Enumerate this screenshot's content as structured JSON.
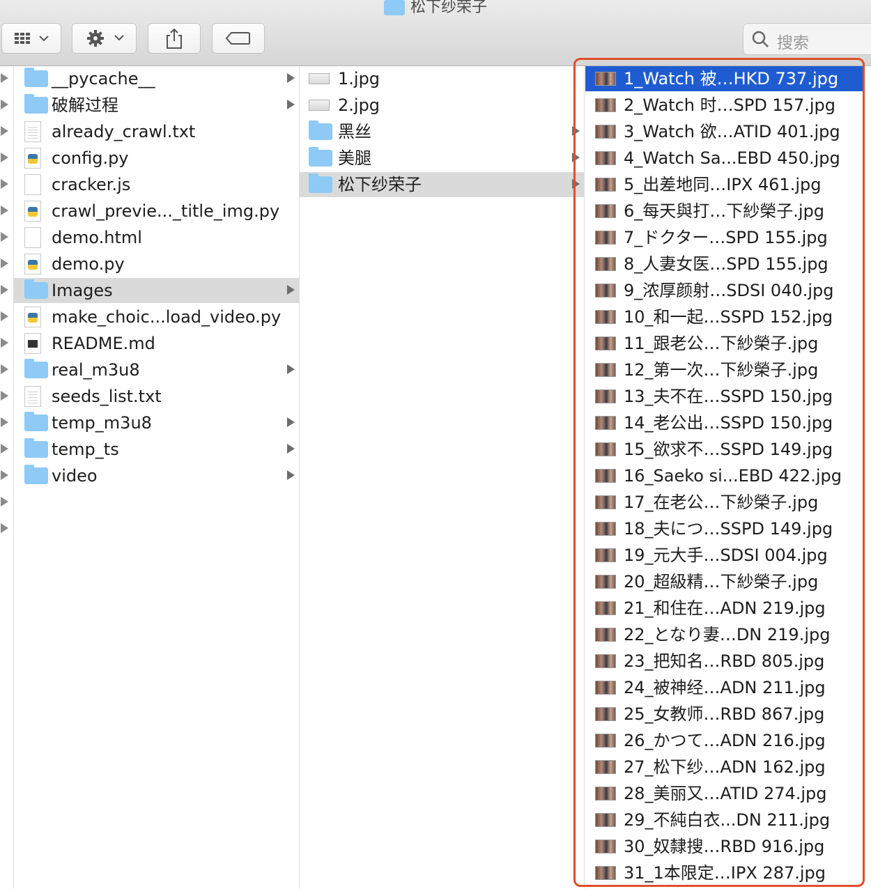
{
  "window": {
    "title": "松下纱荣子"
  },
  "toolbar": {
    "search_placeholder": "搜索"
  },
  "column1": [
    {
      "name": "__pycache__",
      "kind": "folder",
      "arrow": true
    },
    {
      "name": "破解过程",
      "kind": "folder",
      "arrow": true
    },
    {
      "name": "already_crawl.txt",
      "kind": "text"
    },
    {
      "name": "config.py",
      "kind": "python"
    },
    {
      "name": "cracker.js",
      "kind": "blank"
    },
    {
      "name": "crawl_previe..._title_img.py",
      "kind": "python"
    },
    {
      "name": "demo.html",
      "kind": "html"
    },
    {
      "name": "demo.py",
      "kind": "python"
    },
    {
      "name": "Images",
      "kind": "folder",
      "arrow": true,
      "selected": true
    },
    {
      "name": "make_choic...load_video.py",
      "kind": "python"
    },
    {
      "name": "README.md",
      "kind": "markdown"
    },
    {
      "name": "real_m3u8",
      "kind": "folder",
      "arrow": true
    },
    {
      "name": "seeds_list.txt",
      "kind": "text"
    },
    {
      "name": "temp_m3u8",
      "kind": "folder",
      "arrow": true
    },
    {
      "name": "temp_ts",
      "kind": "folder",
      "arrow": true
    },
    {
      "name": "video",
      "kind": "folder",
      "arrow": true
    }
  ],
  "column2": [
    {
      "name": "1.jpg",
      "kind": "jpg"
    },
    {
      "name": "2.jpg",
      "kind": "jpg"
    },
    {
      "name": "黑丝",
      "kind": "folder",
      "arrow": true
    },
    {
      "name": "美腿",
      "kind": "folder",
      "arrow": true
    },
    {
      "name": "松下纱荣子",
      "kind": "folder",
      "arrow": true,
      "selected": true
    }
  ],
  "column3": [
    "1_Watch 被…HKD 737.jpg",
    "2_Watch 时…SPD 157.jpg",
    "3_Watch 欲…ATID 401.jpg",
    "4_Watch Sa...EBD 450.jpg",
    "5_出差地同…IPX 461.jpg",
    "6_每天與打…下紗榮子.jpg",
    "7_ドクター…SPD 155.jpg",
    "8_人妻女医…SPD 155.jpg",
    "9_浓厚颜射…SDSI 040.jpg",
    "10_和一起…SSPD 152.jpg",
    "11_跟老公…下紗榮子.jpg",
    "12_第一次…下紗榮子.jpg",
    "13_夫不在…SSPD 150.jpg",
    "14_老公出…SSPD 150.jpg",
    "15_欲求不…SSPD 149.jpg",
    "16_Saeko si...EBD 422.jpg",
    "17_在老公…下紗榮子.jpg",
    "18_夫につ…SSPD 149.jpg",
    "19_元大手…SDSI 004.jpg",
    "20_超級精…下紗榮子.jpg",
    "21_和住在…ADN 219.jpg",
    "22_となり妻…DN 219.jpg",
    "23_把知名…RBD 805.jpg",
    "24_被神经…ADN 211.jpg",
    "25_女教师…RBD 867.jpg",
    "26_かつて…ADN 216.jpg",
    "27_松下纱…ADN 162.jpg",
    "28_美丽又…ATID 274.jpg",
    "29_不純白衣...DN 211.jpg",
    "30_奴隸搜…RBD 916.jpg",
    "31_1本限定…IPX 287.jpg"
  ],
  "column3_selected_index": 0,
  "colors": {
    "selection_blue": "#1f5cd1",
    "folder_blue": "#8ecaf5",
    "highlight_red": "#e04e2a"
  }
}
